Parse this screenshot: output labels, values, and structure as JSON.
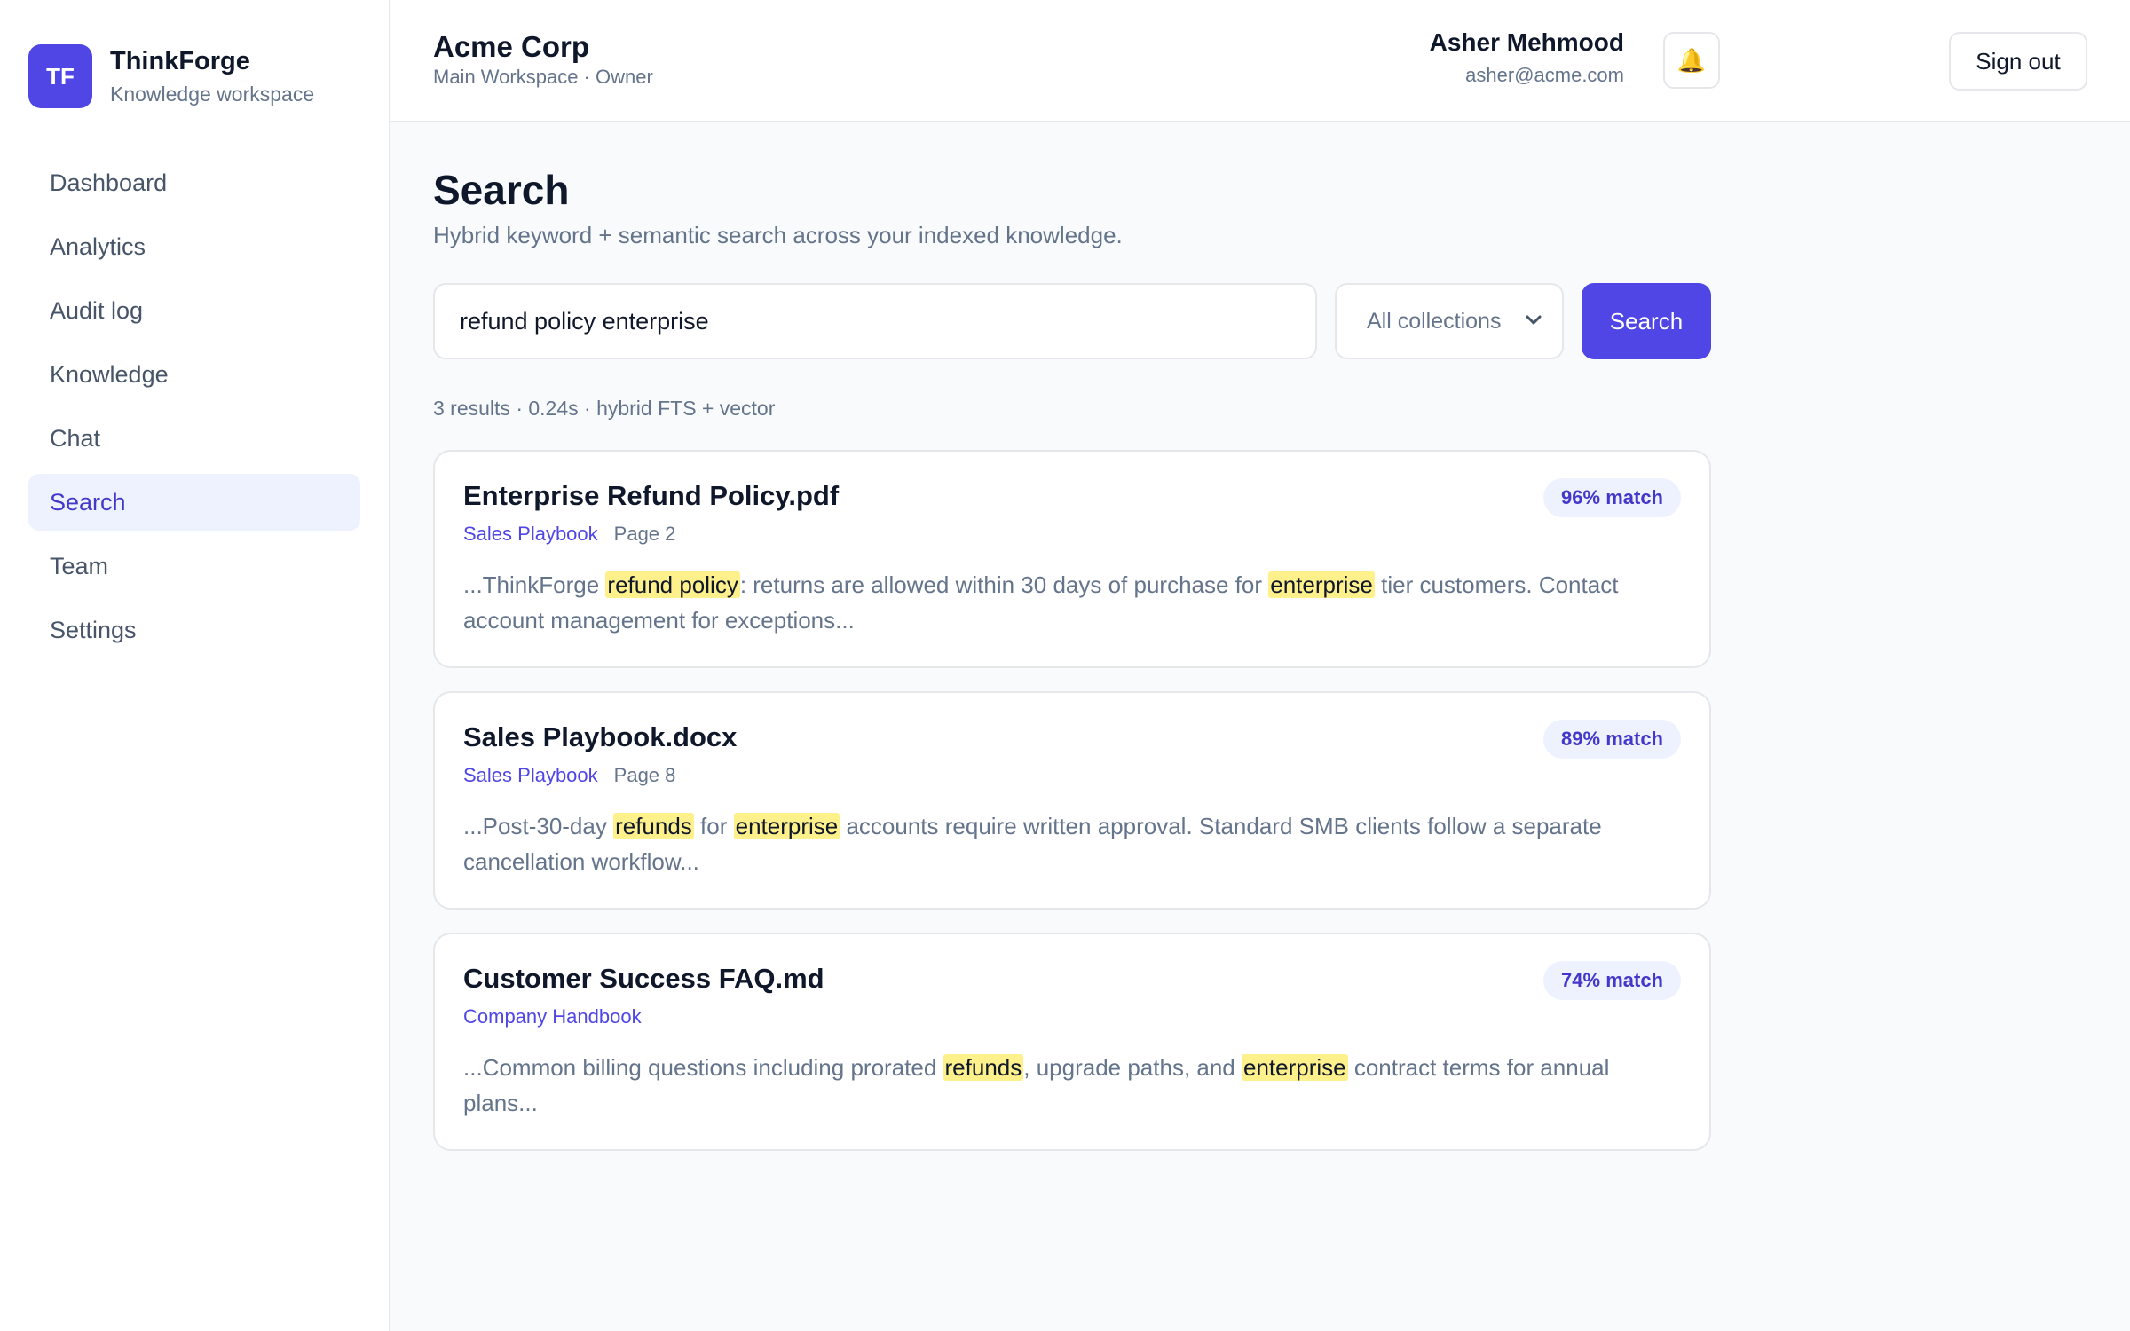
{
  "brand": {
    "logo": "TF",
    "name": "ThinkForge",
    "subtitle": "Knowledge workspace"
  },
  "nav": {
    "items": [
      {
        "label": "Dashboard"
      },
      {
        "label": "Analytics"
      },
      {
        "label": "Audit log"
      },
      {
        "label": "Knowledge"
      },
      {
        "label": "Chat"
      },
      {
        "label": "Search",
        "active": true
      },
      {
        "label": "Team"
      },
      {
        "label": "Settings"
      }
    ]
  },
  "header": {
    "workspace_name": "Acme Corp",
    "workspace_sub": "Main Workspace · Owner",
    "bell_icon": "🔔",
    "user_name": "Asher Mehmood",
    "user_email": "asher@acme.com",
    "signout_label": "Sign out"
  },
  "page": {
    "title": "Search",
    "subtitle": "Hybrid keyword + semantic search across your indexed knowledge."
  },
  "search": {
    "query": "refund policy enterprise",
    "collection": "All collections",
    "button_label": "Search"
  },
  "results_meta": "3 results · 0.24s · hybrid FTS + vector",
  "results": [
    {
      "title": "Enterprise Refund Policy.pdf",
      "collection": "Sales Playbook",
      "page": "Page 2",
      "match": "96% match",
      "snippet": [
        {
          "text": "...ThinkForge "
        },
        {
          "text": "refund policy",
          "hl": true
        },
        {
          "text": ": returns are allowed within 30 days of purchase for "
        },
        {
          "text": "enterprise",
          "hl": true
        },
        {
          "text": " tier customers. Contact account management for exceptions..."
        }
      ]
    },
    {
      "title": "Sales Playbook.docx",
      "collection": "Sales Playbook",
      "page": "Page 8",
      "match": "89% match",
      "snippet": [
        {
          "text": "...Post-30-day "
        },
        {
          "text": "refunds",
          "hl": true
        },
        {
          "text": " for "
        },
        {
          "text": "enterprise",
          "hl": true
        },
        {
          "text": " accounts require written approval. Standard SMB clients follow a separate cancellation workflow..."
        }
      ]
    },
    {
      "title": "Customer Success FAQ.md",
      "collection": "Company Handbook",
      "page": "",
      "match": "74% match",
      "snippet": [
        {
          "text": "...Common billing questions including prorated "
        },
        {
          "text": "refunds",
          "hl": true
        },
        {
          "text": ", upgrade paths, and "
        },
        {
          "text": "enterprise",
          "hl": true
        },
        {
          "text": " contract terms for annual plans..."
        }
      ]
    }
  ],
  "colors": {
    "accent": "#4f46e5",
    "highlight": "#fef08a"
  }
}
